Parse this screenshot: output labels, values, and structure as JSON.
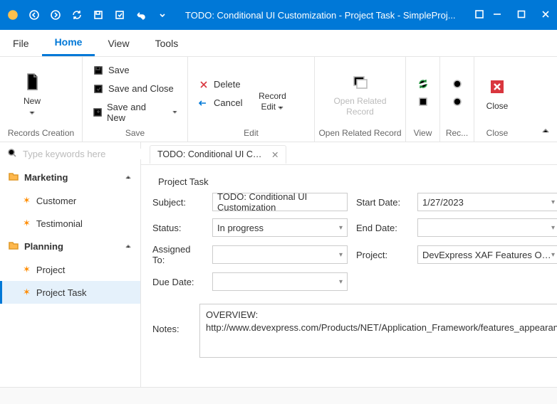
{
  "window": {
    "title": "TODO: Conditional UI Customization - Project Task - SimpleProj..."
  },
  "menu": {
    "file": "File",
    "home": "Home",
    "view": "View",
    "tools": "Tools"
  },
  "ribbon": {
    "records_creation": {
      "label": "Records Creation",
      "new": "New"
    },
    "save_group": {
      "label": "Save",
      "save": "Save",
      "save_close": "Save and Close",
      "save_new": "Save and New"
    },
    "edit_group": {
      "label": "Edit",
      "delete": "Delete",
      "cancel": "Cancel",
      "record_edit": "Record Edit"
    },
    "related_group": {
      "label": "Open Related Record",
      "open_related": "Open Related Record"
    },
    "view_group": {
      "label": "View"
    },
    "rec_group": {
      "label": "Rec..."
    },
    "close_group": {
      "label": "Close",
      "close": "Close"
    }
  },
  "nav": {
    "search_placeholder": "Type keywords here",
    "marketing": "Marketing",
    "customer": "Customer",
    "testimonial": "Testimonial",
    "planning": "Planning",
    "project": "Project",
    "project_task": "Project Task"
  },
  "tab": {
    "title": "TODO: Conditional UI Cust..."
  },
  "form": {
    "header": "Project Task",
    "labels": {
      "subject": "Subject:",
      "status": "Status:",
      "assigned": "Assigned To:",
      "due": "Due Date:",
      "start": "Start Date:",
      "end": "End Date:",
      "project": "Project:",
      "notes": "Notes:"
    },
    "values": {
      "subject": "TODO: Conditional UI Customization",
      "status": "In progress",
      "assigned": "",
      "due": "",
      "start": "1/27/2023",
      "end": "",
      "project": "DevExpress XAF Features Over...",
      "notes": "OVERVIEW:\nhttp://www.devexpress.com/Products/NET/Application_Framework/features_appearance.xml"
    }
  }
}
